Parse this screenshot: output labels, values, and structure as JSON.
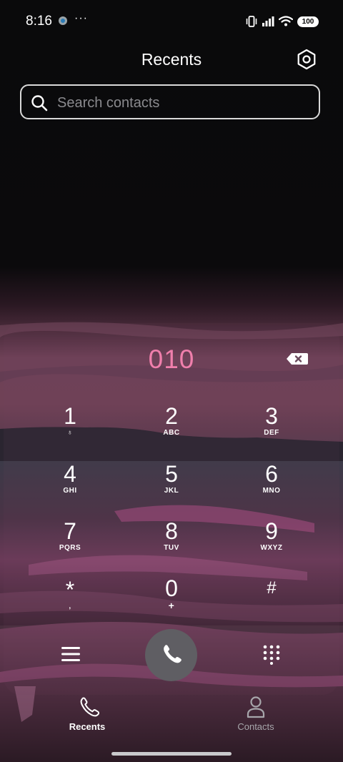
{
  "status_bar": {
    "time": "8:16",
    "overflow_dots": "···",
    "battery": "100",
    "icons": [
      "notification-icon",
      "vibrate-icon",
      "signal-icon",
      "wifi-icon",
      "battery-icon"
    ]
  },
  "header": {
    "title": "Recents",
    "settings_icon": "gear-icon"
  },
  "search": {
    "placeholder": "Search contacts",
    "value": ""
  },
  "dialer": {
    "number": "010",
    "keys": [
      {
        "digit": "1",
        "letters": "♁"
      },
      {
        "digit": "2",
        "letters": "ABC"
      },
      {
        "digit": "3",
        "letters": "DEF"
      },
      {
        "digit": "4",
        "letters": "GHI"
      },
      {
        "digit": "5",
        "letters": "JKL"
      },
      {
        "digit": "6",
        "letters": "MNO"
      },
      {
        "digit": "7",
        "letters": "PQRS"
      },
      {
        "digit": "8",
        "letters": "TUV"
      },
      {
        "digit": "9",
        "letters": "WXYZ"
      },
      {
        "digit": "*",
        "letters": ","
      },
      {
        "digit": "0",
        "letters": "+"
      },
      {
        "digit": "#",
        "letters": ""
      }
    ],
    "colors": {
      "number": "#f07fac",
      "call_button": "#5f5e63"
    }
  },
  "bottom_nav": {
    "items": [
      {
        "label": "Recents",
        "icon": "phone-icon",
        "active": true
      },
      {
        "label": "Contacts",
        "icon": "person-icon",
        "active": false
      }
    ]
  }
}
